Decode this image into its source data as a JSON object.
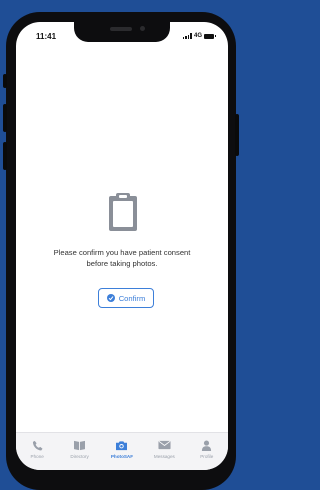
{
  "status_bar": {
    "time": "11:41",
    "network": "4G"
  },
  "consent": {
    "message": "Please confirm you have patient consent before taking photos.",
    "confirm_label": "Confirm"
  },
  "tabs": [
    {
      "label": "Phone",
      "icon": "phone-icon",
      "active": false
    },
    {
      "label": "Directory",
      "icon": "book-icon",
      "active": false
    },
    {
      "label": "PhotoSAF",
      "icon": "camera-icon",
      "active": true
    },
    {
      "label": "Messages",
      "icon": "envelope-icon",
      "active": false
    },
    {
      "label": "Profile",
      "icon": "person-icon",
      "active": false
    }
  ],
  "colors": {
    "accent": "#3d7fd9",
    "background": "#1f4e96",
    "inactive": "#9aa0aa"
  }
}
